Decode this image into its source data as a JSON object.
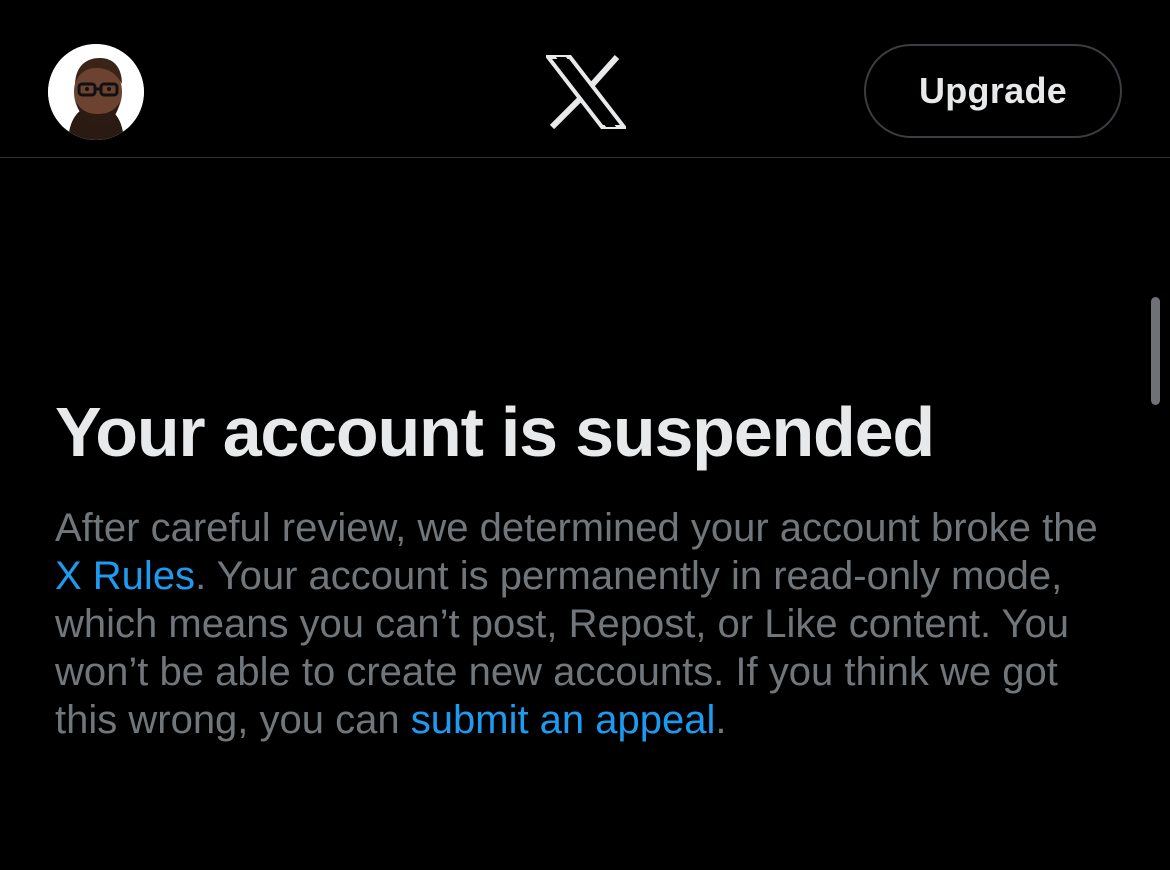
{
  "header": {
    "avatar_name": "avatar",
    "logo_icon": "x-logo-icon",
    "upgrade_label": "Upgrade"
  },
  "main": {
    "title": "Your account is suspended",
    "body_part1": "After careful review, we determined your account broke the ",
    "rules_link": "X Rules",
    "body_part2": ". Your account is permanently in read-only mode, which means you can’t post, Repost, or Like content. You won’t be able to create new accounts. If you think we got this wrong, you can ",
    "appeal_link": "submit an appeal",
    "body_part3": "."
  },
  "colors": {
    "background": "#000000",
    "primary_text": "#e7e9ea",
    "secondary_text": "#71767b",
    "link": "#1d9bf0",
    "border": "#2f3336"
  }
}
